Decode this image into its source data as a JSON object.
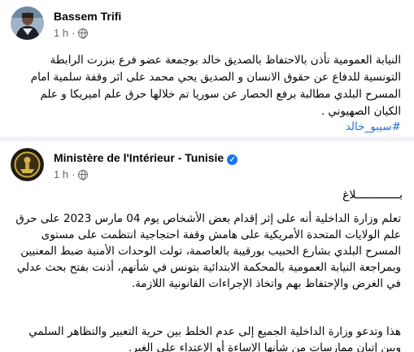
{
  "post1": {
    "author": "Bassem Trifi",
    "time": "1 h",
    "dot": "·",
    "text": "النيابة العمومية تأذن بالاحتفاظ بالصديق خالد بوجمعة عضو فرع بنزرت الرابطة التونسية للدفاع عن حقوق الانسان و الصديق يحي محمد على اثر وقفة سلمية امام المسرح البلدي مطالبة برفع الحصار عن سوريا تم خلالها حرق علم اميريكا و علم الكيان الصهيوني .",
    "hashtag": "#سيبو_خالد"
  },
  "post2": {
    "author": "Ministère de l'Intérieur - Tunisie",
    "verified_glyph": "✓",
    "time": "1 h",
    "dot": "·",
    "announce": "بـــــــــــــلاغ",
    "text": "تعلم وزارة الداخلية أنه على إثر إقدام بعض الأشخاص يوم 04 مارس 2023 على حرق علم الولايات المتحدة الأمريكية على هامش وقفة احتجاجية انتظمت على مستوى المسرح البلدي بشارع الحبيب بورقيبة بالعاصمة، تولت الوحدات الأمنية ضبط المعنيين وبمراجعة النيابة العمومية بالمحكمة الابتدائية بتونس في شأنهم، أذنت بفتح بحث عدلي في الغرض والإحتفاظ بهم واتخاذ الإجراءات القانونية اللازمة.",
    "text2": "هذا وتدعو وزارة الداخلية الجميع إلى عدم الخلط بين حرية التعبير والتظاهر السلمي وبين إتيان ممارسات من شأنها الإساءة أو الإعتداء على الغير."
  },
  "colors": {
    "background": "#f0f2f5",
    "card": "#ffffff",
    "text": "#050505",
    "meta": "#65676b",
    "link": "#216fdb",
    "verified": "#1877f2"
  },
  "icons": [
    "globe-icon",
    "verified-badge-icon",
    "avatar",
    "ministry-logo"
  ]
}
